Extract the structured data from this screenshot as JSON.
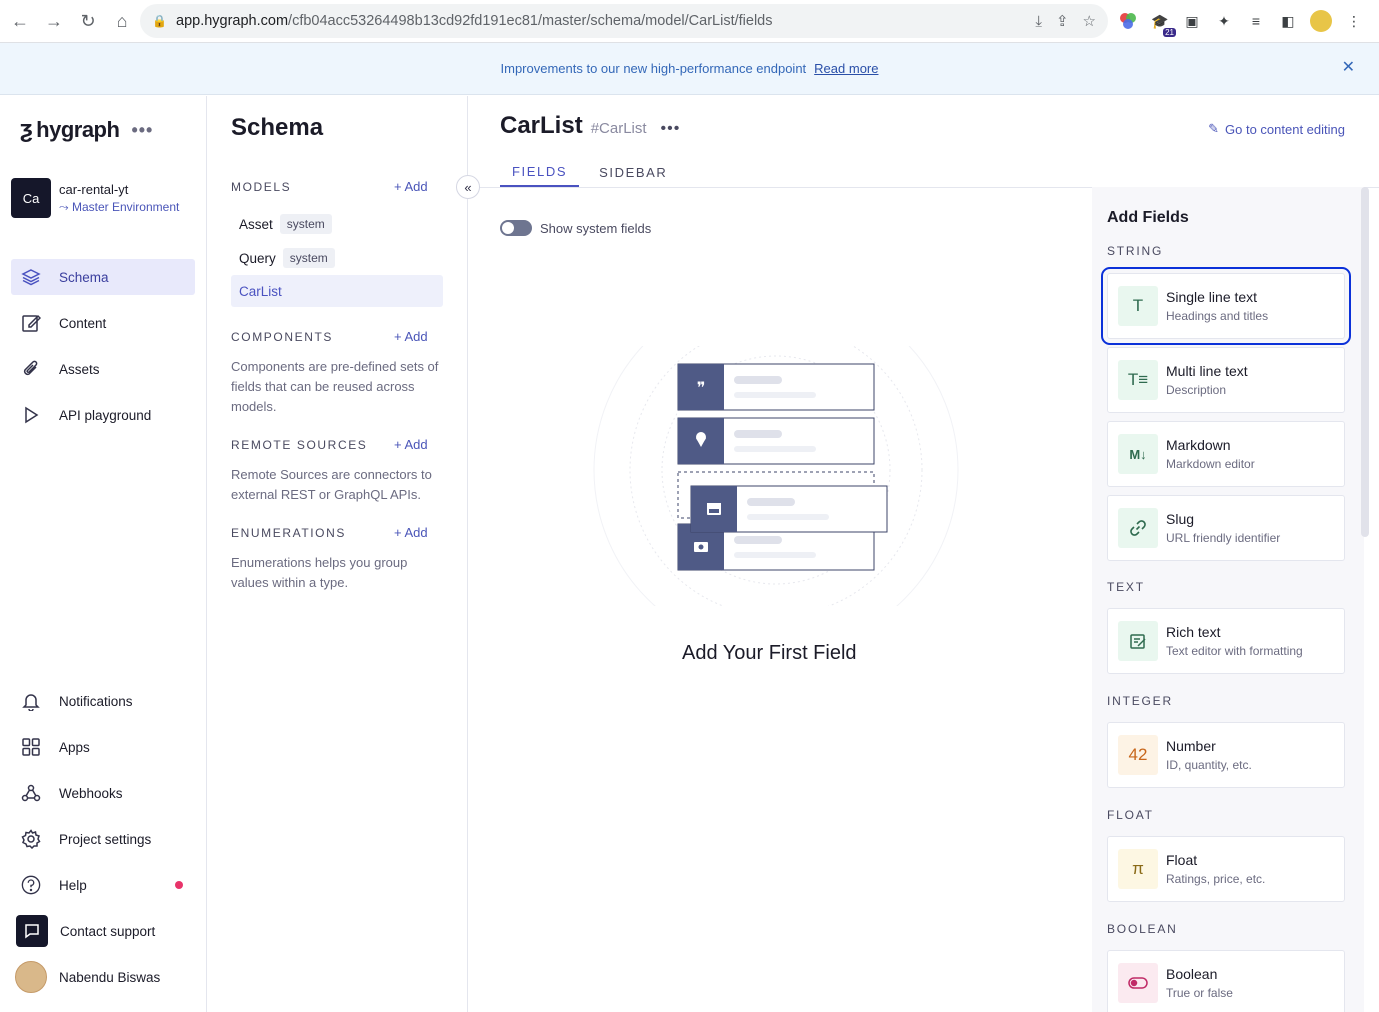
{
  "browser": {
    "url_host": "app.hygraph.com",
    "url_path": "/cfb04acc53264498b13cd92fd191ec81/master/schema/model/CarList/fields",
    "ext_badge": "21"
  },
  "banner": {
    "text": "Improvements to our new high-performance endpoint",
    "link": "Read more"
  },
  "sidebar": {
    "logo": "hygraph",
    "project_initials": "Ca",
    "project_name": "car-rental-yt",
    "environment": "Master Environment",
    "nav": [
      {
        "label": "Schema",
        "icon": "layers-icon"
      },
      {
        "label": "Content",
        "icon": "edit-icon"
      },
      {
        "label": "Assets",
        "icon": "paperclip-icon"
      },
      {
        "label": "API playground",
        "icon": "play-icon"
      }
    ],
    "bottom": [
      {
        "label": "Notifications",
        "icon": "bell-icon"
      },
      {
        "label": "Apps",
        "icon": "apps-icon"
      },
      {
        "label": "Webhooks",
        "icon": "webhook-icon"
      },
      {
        "label": "Project settings",
        "icon": "gear-icon"
      },
      {
        "label": "Help",
        "icon": "help-icon"
      },
      {
        "label": "Contact support",
        "icon": "chat-icon"
      },
      {
        "label": "Nabendu Biswas",
        "icon": "avatar"
      }
    ]
  },
  "schema": {
    "title": "Schema",
    "models_label": "MODELS",
    "add_label": "Add",
    "models": [
      {
        "name": "Asset",
        "tag": "system"
      },
      {
        "name": "Query",
        "tag": "system"
      },
      {
        "name": "CarList",
        "tag": ""
      }
    ],
    "components_label": "COMPONENTS",
    "components_desc": "Components are pre-defined sets of fields that can be reused across models.",
    "remote_label": "REMOTE SOURCES",
    "remote_desc": "Remote Sources are connectors to external REST or GraphQL APIs.",
    "enum_label": "ENUMERATIONS",
    "enum_desc": "Enumerations helps you group values within a type."
  },
  "main": {
    "model_name": "CarList",
    "model_api": "#CarList",
    "goto": "Go to content editing",
    "tabs": [
      "FIELDS",
      "SIDEBAR"
    ],
    "toggle_label": "Show system fields",
    "empty_title": "Add Your First Field"
  },
  "fields": {
    "title": "Add Fields",
    "categories": {
      "string": "STRING",
      "text": "TEXT",
      "integer": "INTEGER",
      "float": "FLOAT",
      "boolean": "BOOLEAN"
    },
    "items": [
      {
        "name": "Single line text",
        "desc": "Headings and titles",
        "icon_glyph": "T"
      },
      {
        "name": "Multi line text",
        "desc": "Description",
        "icon_glyph": "T≡"
      },
      {
        "name": "Markdown",
        "desc": "Markdown editor",
        "icon_glyph": "M↓"
      },
      {
        "name": "Slug",
        "desc": "URL friendly identifier",
        "icon_glyph": "🔗"
      },
      {
        "name": "Rich text",
        "desc": "Text editor with formatting",
        "icon_glyph": "✎"
      },
      {
        "name": "Number",
        "desc": "ID, quantity, etc.",
        "icon_glyph": "42"
      },
      {
        "name": "Float",
        "desc": "Ratings, price, etc.",
        "icon_glyph": "π"
      },
      {
        "name": "Boolean",
        "desc": "True or false",
        "icon_glyph": "⊙"
      }
    ]
  }
}
